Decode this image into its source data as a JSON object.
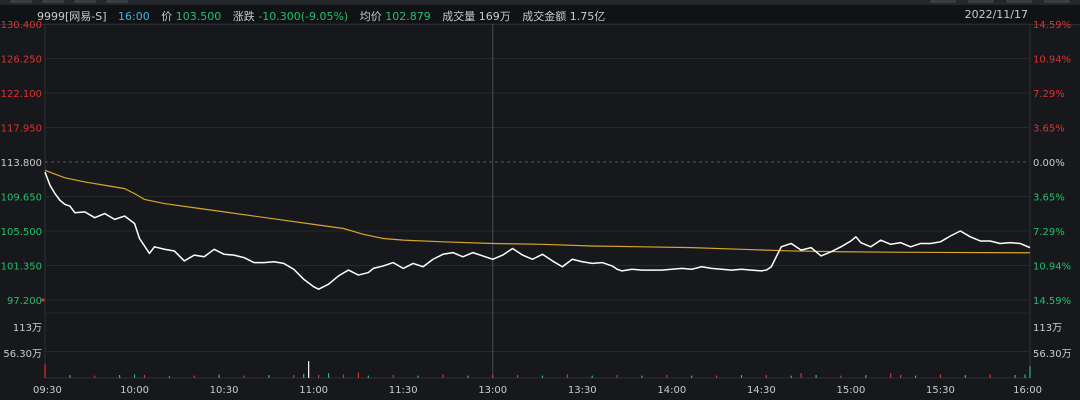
{
  "header": {
    "code_name": "9999[网易-S]",
    "time": "16:00",
    "price_label": "价",
    "price": "103.500",
    "change_label": "涨跌",
    "change": "-10.300(-9.05%)",
    "avg_label": "均价",
    "avg": "102.879",
    "volume_label": "成交量",
    "volume": "169万",
    "turnover_label": "成交金额",
    "turnover": "1.75亿",
    "date": "2022/11/17"
  },
  "colors": {
    "up": "#e0312d",
    "down": "#1fc16b",
    "neutral": "#c9cbcf",
    "price_line": "#ffffff",
    "avg_line": "#d7a62a"
  },
  "chart_data": {
    "type": "line",
    "prev_close": 113.8,
    "ylim": [
      97.2,
      130.4
    ],
    "y_ticks_left": [
      "130.400",
      "126.250",
      "122.100",
      "117.950",
      "113.800",
      "109.650",
      "105.500",
      "101.350",
      "97.200"
    ],
    "y_ticks_right": [
      "14.59%",
      "10.94%",
      "7.29%",
      "3.65%",
      "0.00%",
      "3.65%",
      "7.29%",
      "10.94%",
      "14.59%"
    ],
    "volume_ticks_left": [
      "113万",
      "56.30万"
    ],
    "volume_ticks_right": [
      "113万",
      "56.30万"
    ],
    "x_ticks": [
      "09:30",
      "10:00",
      "10:30",
      "11:00",
      "11:30",
      "13:00",
      "13:30",
      "14:00",
      "14:30",
      "15:00",
      "15:30",
      "16:00"
    ],
    "series": [
      {
        "name": "价",
        "points": [
          [
            0,
            112.6
          ],
          [
            1,
            111.0
          ],
          [
            2,
            110.0
          ],
          [
            3,
            109.2
          ],
          [
            4,
            108.7
          ],
          [
            5,
            108.5
          ],
          [
            6,
            107.7
          ],
          [
            8,
            107.8
          ],
          [
            10,
            107.1
          ],
          [
            12,
            107.6
          ],
          [
            14,
            106.9
          ],
          [
            16,
            107.3
          ],
          [
            18,
            106.4
          ],
          [
            19,
            104.6
          ],
          [
            21,
            102.8
          ],
          [
            22,
            103.6
          ],
          [
            24,
            103.3
          ],
          [
            26,
            103.1
          ],
          [
            28,
            101.9
          ],
          [
            30,
            102.6
          ],
          [
            32,
            102.4
          ],
          [
            34,
            103.3
          ],
          [
            36,
            102.7
          ],
          [
            38,
            102.6
          ],
          [
            40,
            102.3
          ],
          [
            42,
            101.7
          ],
          [
            44,
            101.7
          ],
          [
            46,
            101.8
          ],
          [
            48,
            101.6
          ],
          [
            50,
            100.9
          ],
          [
            52,
            99.7
          ],
          [
            54,
            98.8
          ],
          [
            55,
            98.5
          ],
          [
            57,
            99.1
          ],
          [
            59,
            100.1
          ],
          [
            61,
            100.8
          ],
          [
            63,
            100.2
          ],
          [
            65,
            100.5
          ],
          [
            66,
            101.0
          ],
          [
            68,
            101.3
          ],
          [
            70,
            101.7
          ],
          [
            72,
            101.0
          ],
          [
            74,
            101.6
          ],
          [
            76,
            101.2
          ],
          [
            78,
            102.1
          ],
          [
            80,
            102.7
          ],
          [
            82,
            102.9
          ],
          [
            84,
            102.4
          ],
          [
            86,
            102.9
          ],
          [
            88,
            102.5
          ],
          [
            90,
            102.1
          ],
          [
            92,
            102.6
          ],
          [
            94,
            103.4
          ],
          [
            96,
            102.6
          ],
          [
            98,
            102.1
          ],
          [
            100,
            102.7
          ],
          [
            102,
            101.9
          ],
          [
            104,
            101.2
          ],
          [
            106,
            102.1
          ],
          [
            108,
            101.8
          ],
          [
            110,
            101.6
          ],
          [
            112,
            101.7
          ],
          [
            114,
            101.3
          ],
          [
            115,
            100.9
          ],
          [
            116,
            100.7
          ],
          [
            118,
            100.9
          ],
          [
            120,
            100.8
          ],
          [
            122,
            100.8
          ],
          [
            124,
            100.8
          ],
          [
            126,
            100.9
          ],
          [
            128,
            101.0
          ],
          [
            130,
            100.9
          ],
          [
            132,
            101.2
          ],
          [
            134,
            101.0
          ],
          [
            136,
            100.9
          ],
          [
            138,
            100.8
          ],
          [
            140,
            100.9
          ],
          [
            142,
            100.8
          ],
          [
            144,
            100.7
          ],
          [
            145,
            100.8
          ],
          [
            146,
            101.2
          ],
          [
            148,
            103.6
          ],
          [
            150,
            104.0
          ],
          [
            152,
            103.2
          ],
          [
            154,
            103.5
          ],
          [
            156,
            102.5
          ],
          [
            158,
            103.0
          ],
          [
            160,
            103.6
          ],
          [
            162,
            104.3
          ],
          [
            163,
            104.8
          ],
          [
            164,
            104.1
          ],
          [
            166,
            103.6
          ],
          [
            168,
            104.4
          ],
          [
            170,
            103.9
          ],
          [
            172,
            104.1
          ],
          [
            174,
            103.6
          ],
          [
            176,
            104.0
          ],
          [
            178,
            104.0
          ],
          [
            180,
            104.2
          ],
          [
            182,
            104.9
          ],
          [
            184,
            105.5
          ],
          [
            186,
            104.8
          ],
          [
            188,
            104.3
          ],
          [
            190,
            104.3
          ],
          [
            192,
            104.0
          ],
          [
            194,
            104.1
          ],
          [
            196,
            104.0
          ],
          [
            198,
            103.5
          ]
        ]
      },
      {
        "name": "均价",
        "points": [
          [
            0,
            112.8
          ],
          [
            4,
            111.9
          ],
          [
            8,
            111.4
          ],
          [
            12,
            111.0
          ],
          [
            16,
            110.6
          ],
          [
            18,
            110.0
          ],
          [
            20,
            109.3
          ],
          [
            24,
            108.8
          ],
          [
            30,
            108.3
          ],
          [
            36,
            107.8
          ],
          [
            42,
            107.3
          ],
          [
            48,
            106.8
          ],
          [
            54,
            106.3
          ],
          [
            60,
            105.8
          ],
          [
            64,
            105.1
          ],
          [
            68,
            104.6
          ],
          [
            72,
            104.4
          ],
          [
            80,
            104.2
          ],
          [
            90,
            104.0
          ],
          [
            100,
            103.9
          ],
          [
            110,
            103.7
          ],
          [
            120,
            103.6
          ],
          [
            130,
            103.5
          ],
          [
            140,
            103.3
          ],
          [
            150,
            103.1
          ],
          [
            160,
            103.0
          ],
          [
            170,
            102.95
          ],
          [
            180,
            102.92
          ],
          [
            190,
            102.9
          ],
          [
            198,
            102.88
          ]
        ]
      }
    ],
    "volume": [
      [
        0,
        23,
        "up"
      ],
      [
        5,
        5,
        "down"
      ],
      [
        10,
        4,
        "up"
      ],
      [
        15,
        5,
        "down"
      ],
      [
        18,
        6,
        "down"
      ],
      [
        20,
        5,
        "up"
      ],
      [
        25,
        3,
        "down"
      ],
      [
        30,
        4,
        "up"
      ],
      [
        35,
        6,
        "down"
      ],
      [
        40,
        4,
        "up"
      ],
      [
        45,
        5,
        "down"
      ],
      [
        50,
        5,
        "up"
      ],
      [
        52,
        7,
        "down"
      ],
      [
        53,
        28,
        "neutral"
      ],
      [
        55,
        5,
        "up"
      ],
      [
        57,
        8,
        "down"
      ],
      [
        60,
        6,
        "up"
      ],
      [
        63,
        9,
        "up"
      ],
      [
        65,
        4,
        "down"
      ],
      [
        70,
        5,
        "up"
      ],
      [
        75,
        4,
        "down"
      ],
      [
        80,
        6,
        "up"
      ],
      [
        85,
        4,
        "down"
      ],
      [
        90,
        5,
        "up"
      ],
      [
        95,
        5,
        "up"
      ],
      [
        100,
        4,
        "down"
      ],
      [
        105,
        6,
        "up"
      ],
      [
        110,
        4,
        "down"
      ],
      [
        115,
        5,
        "up"
      ],
      [
        120,
        4,
        "down"
      ],
      [
        125,
        5,
        "up"
      ],
      [
        130,
        4,
        "down"
      ],
      [
        135,
        4,
        "up"
      ],
      [
        140,
        5,
        "down"
      ],
      [
        145,
        5,
        "up"
      ],
      [
        150,
        4,
        "down"
      ],
      [
        152,
        8,
        "up"
      ],
      [
        155,
        5,
        "down"
      ],
      [
        160,
        4,
        "up"
      ],
      [
        165,
        5,
        "down"
      ],
      [
        170,
        8,
        "up"
      ],
      [
        172,
        5,
        "up"
      ],
      [
        175,
        4,
        "down"
      ],
      [
        180,
        6,
        "up"
      ],
      [
        185,
        5,
        "down"
      ],
      [
        190,
        6,
        "up"
      ],
      [
        195,
        5,
        "down"
      ],
      [
        197,
        6,
        "down"
      ],
      [
        198,
        20,
        "down"
      ]
    ],
    "volume_ylim": [
      0,
      113
    ]
  }
}
